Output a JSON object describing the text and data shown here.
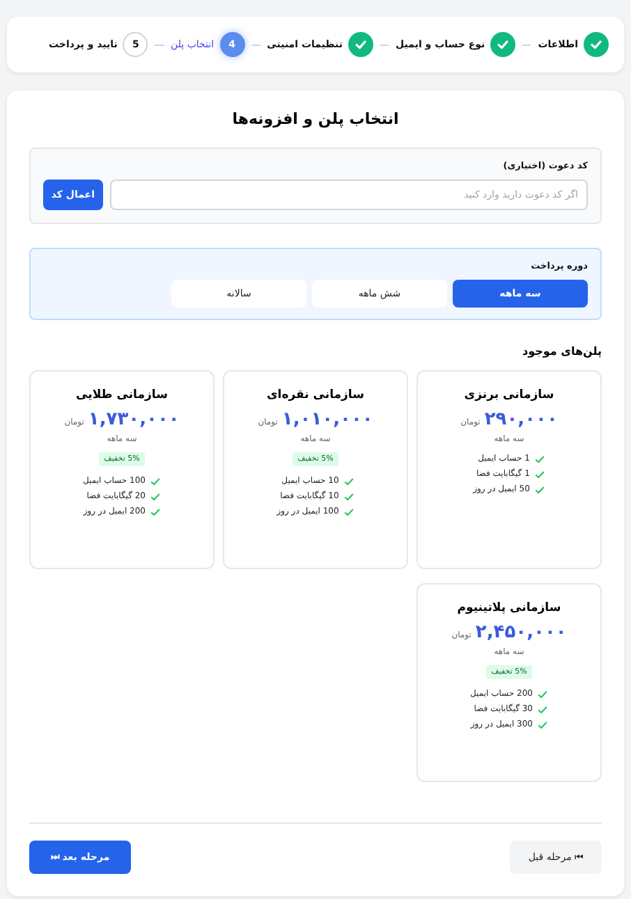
{
  "steps": [
    {
      "label": "اطلاعات",
      "completed": true,
      "selected": false
    },
    {
      "label": "نوع حساب و ایمیل",
      "completed": true,
      "selected": false
    },
    {
      "label": "تنظیمات امنیتی",
      "completed": true,
      "selected": false
    },
    {
      "number": "4",
      "label": "انتخاب پلن",
      "completed": false,
      "selected": true
    },
    {
      "number": "5",
      "label": "تایید و پرداخت",
      "completed": false,
      "selected": false
    }
  ],
  "title": "انتخاب پلن و افزونه‌ها",
  "invite": {
    "label": "کد دعوت (اختیاری)",
    "placeholder": "اگر کد دعوت دارید وارد کنید",
    "button": "اعمال کد"
  },
  "billing": {
    "label": "دوره پرداخت",
    "options": [
      {
        "label": "سه ماهه",
        "selected": true
      },
      {
        "label": "شش ماهه",
        "selected": false
      },
      {
        "label": "سالانه",
        "selected": false
      }
    ]
  },
  "plans_heading": "پلن‌های موجود",
  "plans": [
    {
      "name": "سازمانی برنزی",
      "price": "۲۹۰,۰۰۰",
      "currency": "تومان",
      "period": "سه ماهه",
      "features": [
        "1 حساب ایمیل",
        "1 گیگابایت فضا",
        "50 ایمیل در روز"
      ]
    },
    {
      "name": "سازمانی نقره‌ای",
      "price": "۱,۰۱۰,۰۰۰",
      "currency": "تومان",
      "period": "سه ماهه",
      "discount": "5% تخفیف",
      "features": [
        "10 حساب ایمیل",
        "10 گیگابایت فضا",
        "100 ایمیل در روز"
      ]
    },
    {
      "name": "سازمانی طلایی",
      "price": "۱,۷۳۰,۰۰۰",
      "currency": "تومان",
      "period": "سه ماهه",
      "discount": "5% تخفیف",
      "features": [
        "100 حساب ایمیل",
        "20 گیگابایت فضا",
        "200 ایمیل در روز"
      ]
    },
    {
      "name": "سازمانی پلاتینیوم",
      "price": "۲,۴۵۰,۰۰۰",
      "currency": "تومان",
      "period": "سه ماهه",
      "discount": "5% تخفیف",
      "features": [
        "200 حساب ایمیل",
        "30 گیگابایت فضا",
        "300 ایمیل در روز"
      ]
    }
  ],
  "footer": {
    "previous": "⏮ مرحله قبل",
    "next": "مرحله بعد ⏭"
  }
}
